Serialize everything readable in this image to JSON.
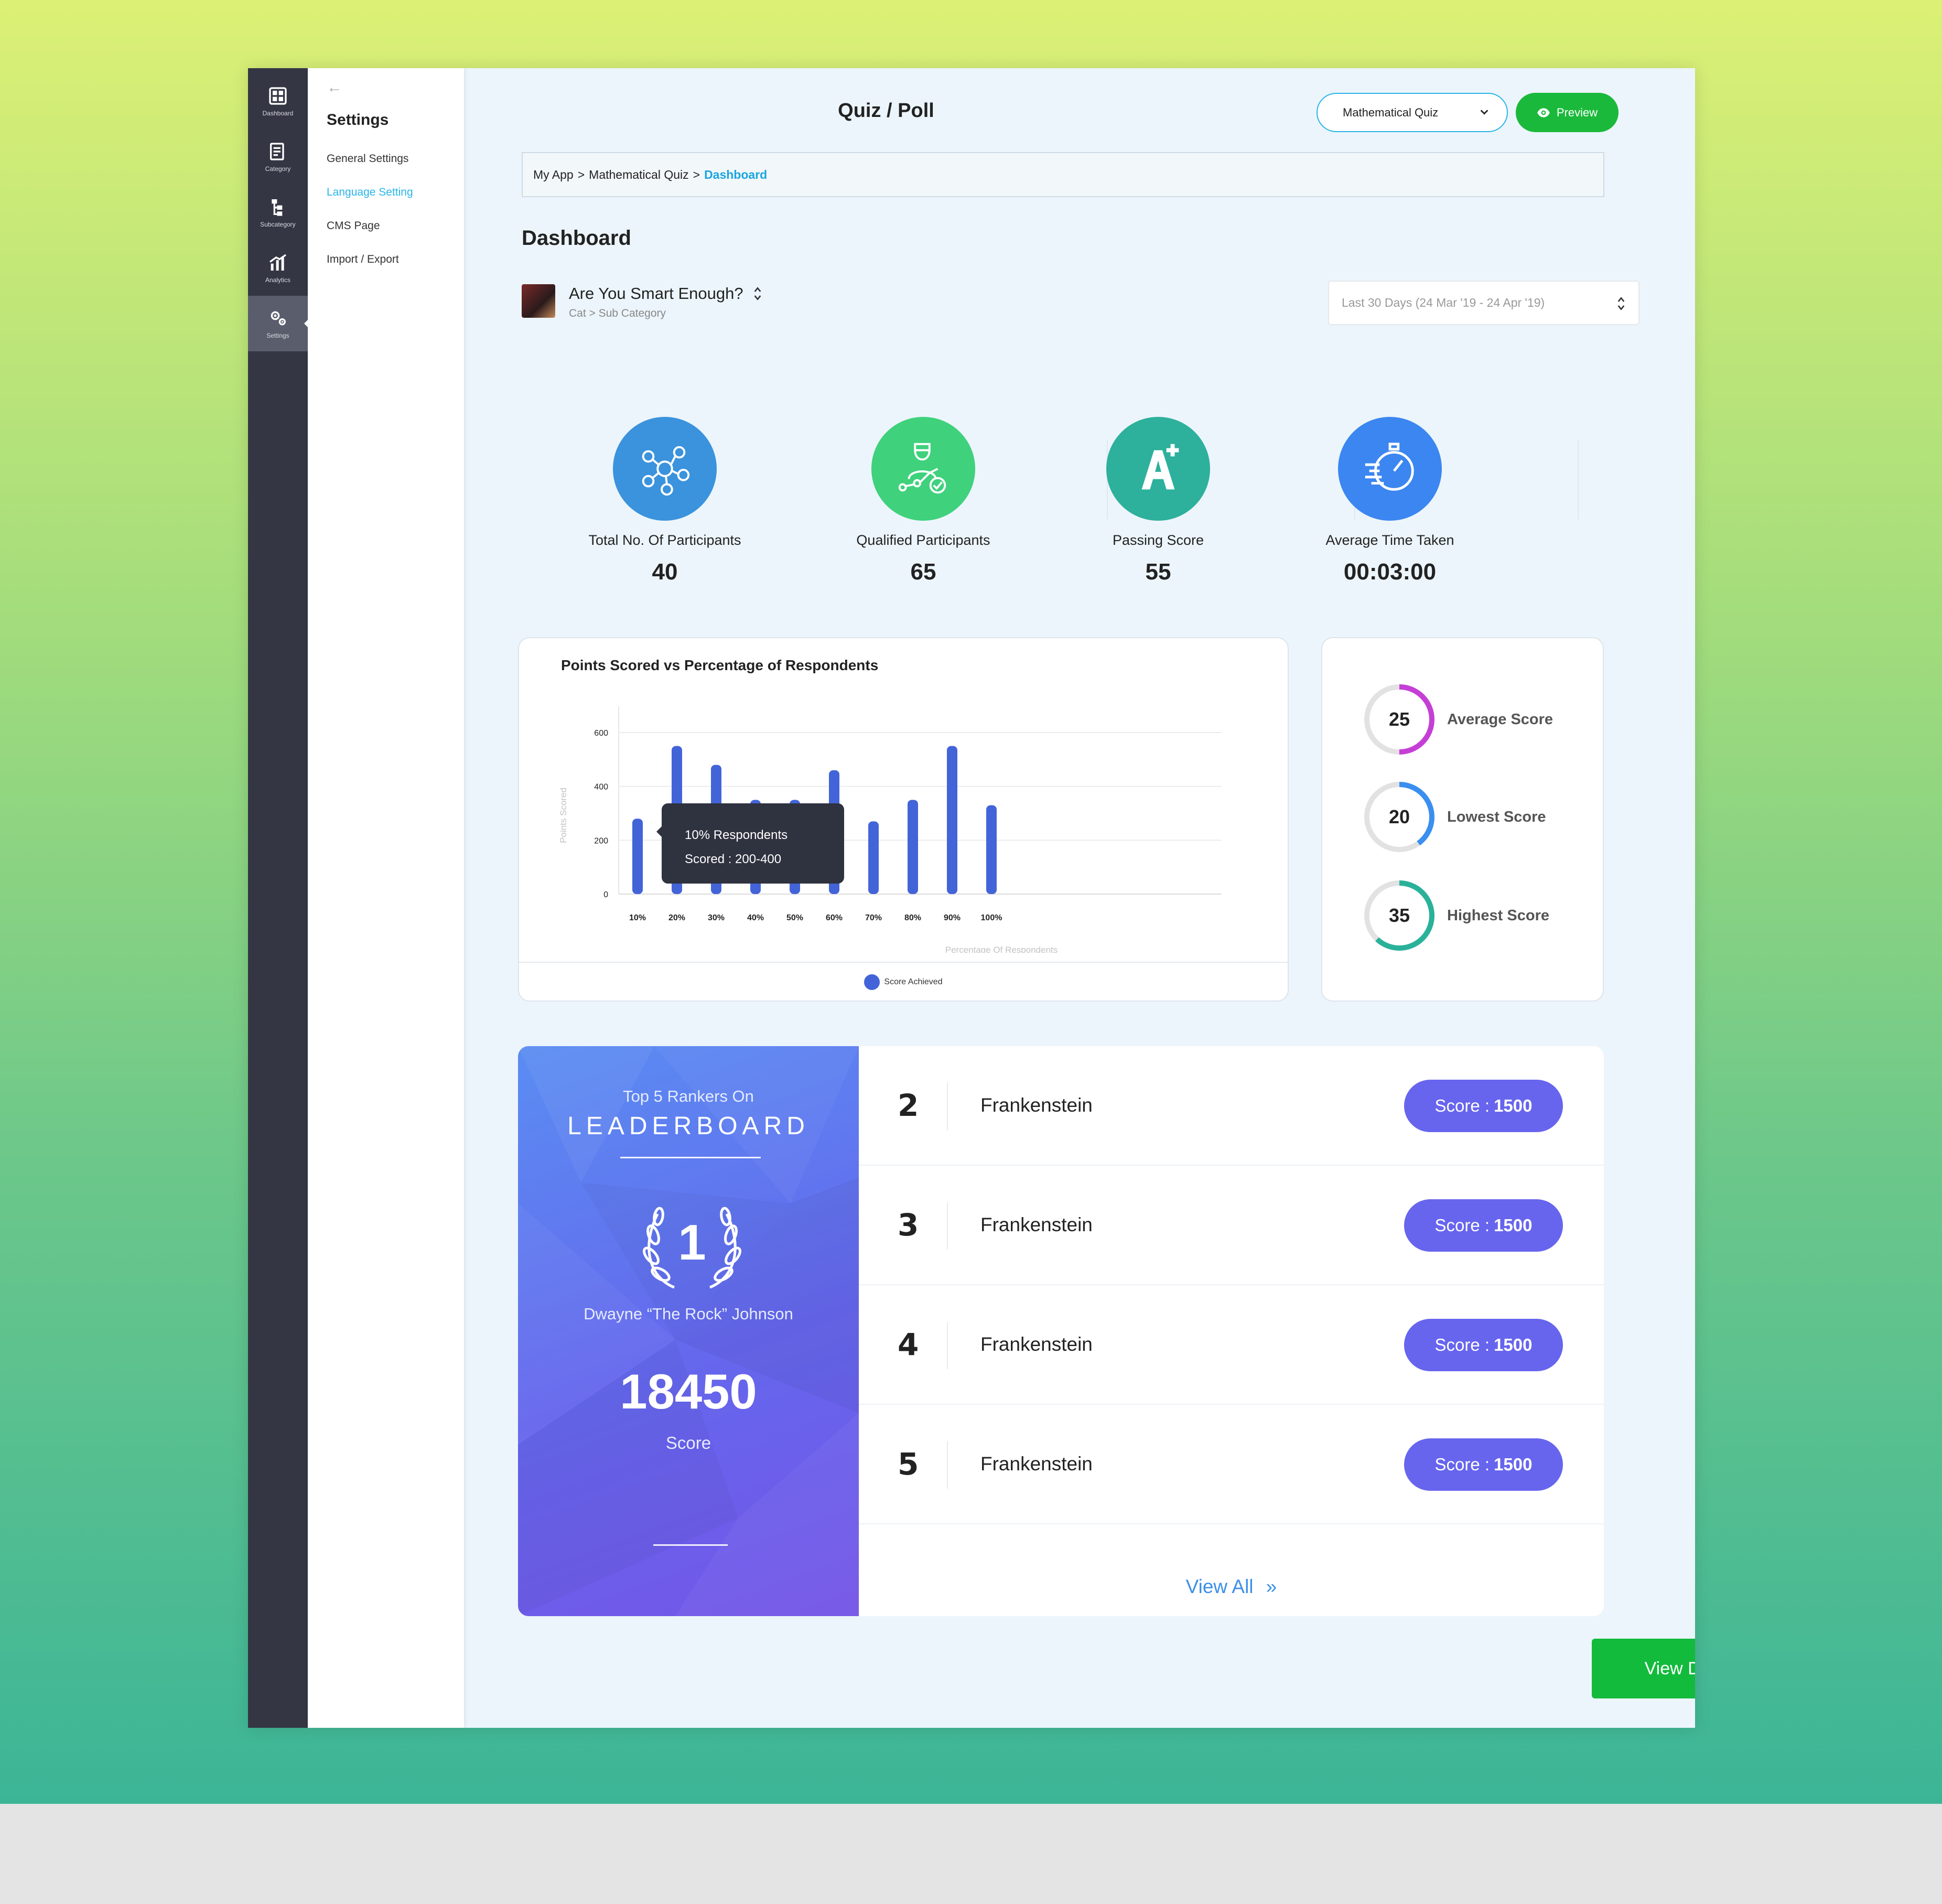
{
  "rail": {
    "items": [
      {
        "label": "Dashboard",
        "icon": "dashboard-icon"
      },
      {
        "label": "Category",
        "icon": "category-icon"
      },
      {
        "label": "Subcategory",
        "icon": "subcategory-icon"
      },
      {
        "label": "Analytics",
        "icon": "analytics-icon"
      },
      {
        "label": "Settings",
        "icon": "settings-icon"
      }
    ],
    "active": "Settings"
  },
  "settings_panel": {
    "back_glyph": "←",
    "title": "Settings",
    "items": [
      {
        "label": "General Settings"
      },
      {
        "label": "Language Setting"
      },
      {
        "label": "CMS Page"
      },
      {
        "label": "Import / Export"
      }
    ],
    "active": "Language Setting"
  },
  "header": {
    "title": "Quiz / Poll",
    "quiz_select_value": "Mathematical Quiz",
    "preview_label": "Preview"
  },
  "breadcrumb": {
    "parts": [
      "My App",
      "Mathematical Quiz"
    ],
    "separator": ">",
    "current": "Dashboard"
  },
  "dashboard": {
    "title": "Dashboard",
    "quiz_name": "Are You Smart Enough?",
    "quiz_category": "Cat > Sub Category",
    "date_range": "Last 30 Days (24 Mar '19 - 24 Apr '19)"
  },
  "stats": [
    {
      "label": "Total No. Of Participants",
      "value": "40",
      "color": "#3a93dc",
      "icon": "participants-network-icon"
    },
    {
      "label": "Qualified Participants",
      "value": "65",
      "color": "#3fd17c",
      "icon": "qualified-person-icon"
    },
    {
      "label": "Passing Score",
      "value": "55",
      "color": "#2db09c",
      "icon": "grade-a-plus-icon"
    },
    {
      "label": "Average Time Taken",
      "value": "00:03:00",
      "color": "#3b86f0",
      "icon": "stopwatch-icon"
    }
  ],
  "chart_data": {
    "type": "bar",
    "title": "Points Scored vs Percentage of Respondents",
    "xlabel": "Percentage Of Respondents",
    "ylabel": "Points Scored",
    "categories": [
      "10%",
      "20%",
      "30%",
      "40%",
      "50%",
      "60%",
      "70%",
      "80%",
      "90%",
      "100%"
    ],
    "series": [
      {
        "name": "Score Achieved",
        "values": [
          280,
          550,
          480,
          350,
          350,
          460,
          270,
          350,
          550,
          330
        ]
      }
    ],
    "yticks": [
      0,
      200,
      400,
      600
    ],
    "ylim": [
      0,
      680
    ],
    "grid": true,
    "legend": "bottom-center",
    "color": "#4364d8",
    "tooltip": {
      "line1": "10% Respondents",
      "line2": "Scored : 200-400"
    }
  },
  "score_summary": [
    {
      "value": "25",
      "label": "Average Score",
      "color": "#c53fd6",
      "fraction": 0.5
    },
    {
      "value": "20",
      "label": "Lowest Score",
      "color": "#3a8ff0",
      "fraction": 0.4
    },
    {
      "value": "35",
      "label": "Highest Score",
      "color": "#2ab19a",
      "fraction": 0.62
    }
  ],
  "leaderboard": {
    "heading_small": "Top 5 Rankers On",
    "heading_big": "LEADERBOARD",
    "first_rank": "1",
    "first_name": "Dwayne “The Rock” Johnson",
    "first_score": "18450",
    "score_label": "Score",
    "rows": [
      {
        "rank": "2",
        "name": "Frankenstein",
        "score_prefix": "Score :",
        "score": "1500"
      },
      {
        "rank": "3",
        "name": "Frankenstein",
        "score_prefix": "Score :",
        "score": "1500"
      },
      {
        "rank": "4",
        "name": "Frankenstein",
        "score_prefix": "Score :",
        "score": "1500"
      },
      {
        "rank": "5",
        "name": "Frankenstein",
        "score_prefix": "Score :",
        "score": "1500"
      }
    ],
    "view_all": "View All",
    "view_all_glyph": "»"
  },
  "report_button": "View Detailed Report"
}
